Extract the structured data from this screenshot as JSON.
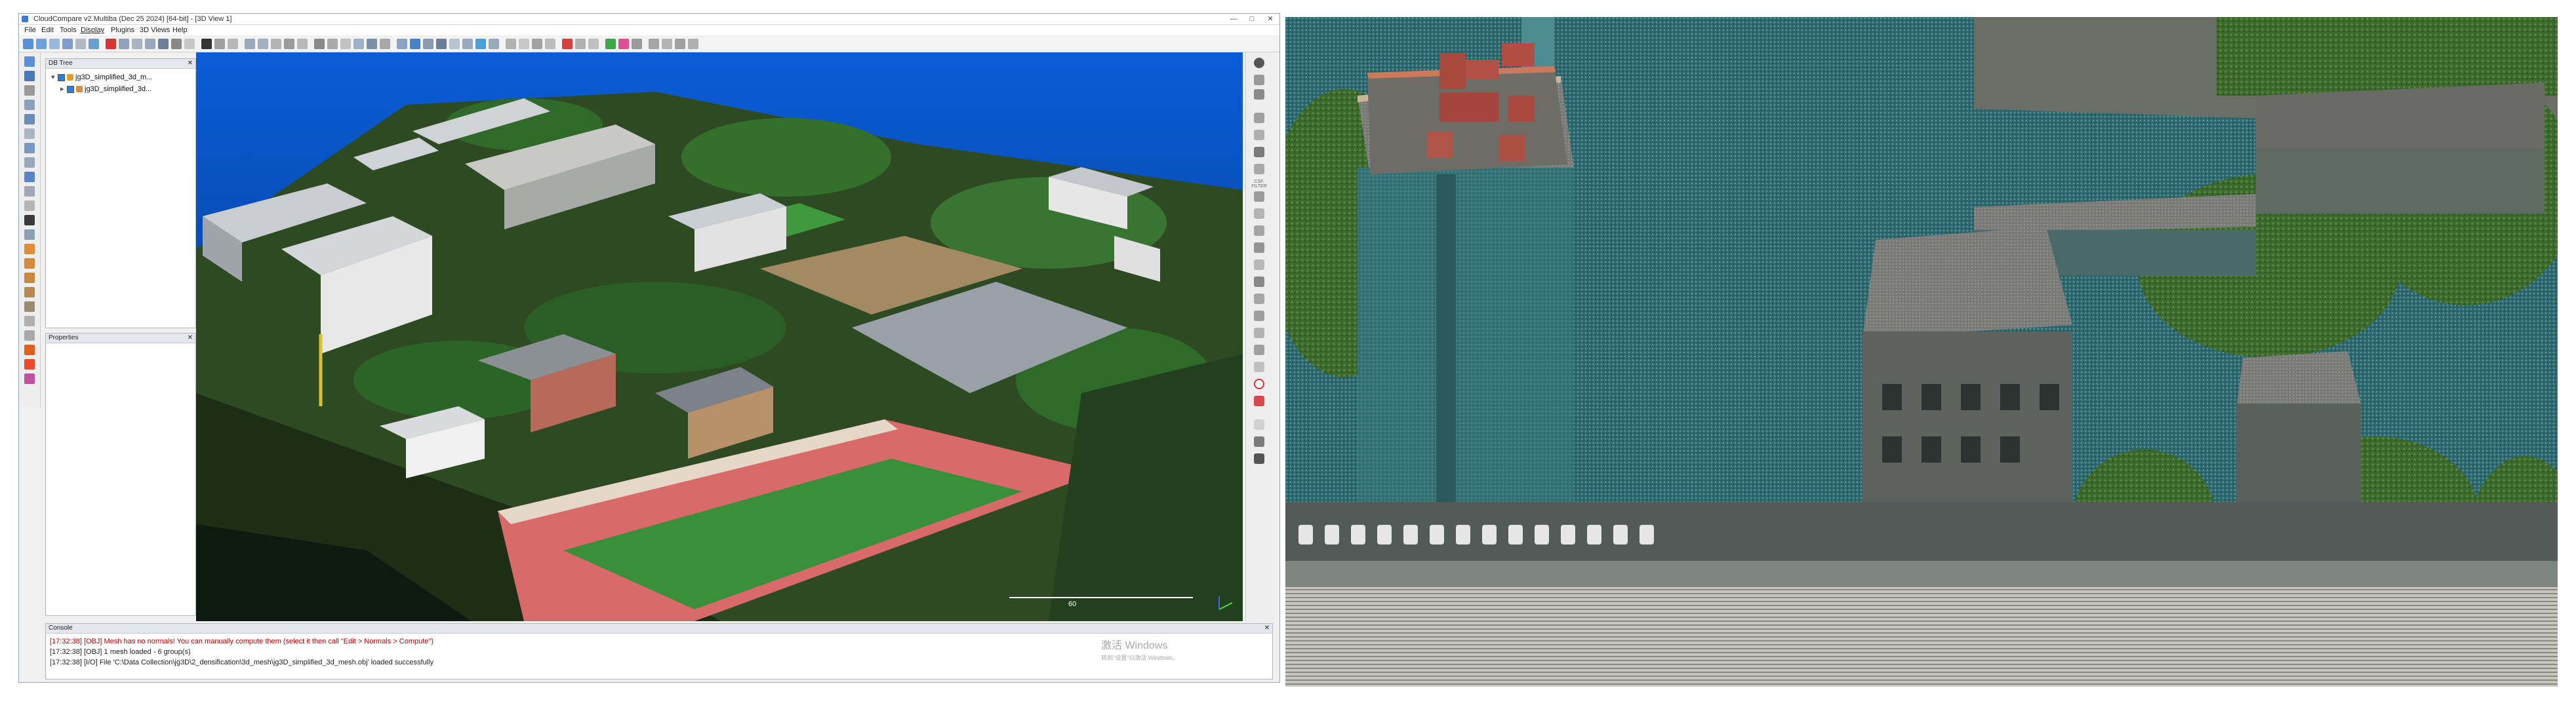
{
  "window": {
    "title": "CloudCompare v2.Multiba (Dec 25 2024) [64-bit] - [3D View 1]",
    "min_glyph": "—",
    "max_glyph": "□",
    "close_glyph": "✕"
  },
  "menu": [
    "File",
    "Edit",
    "Tools",
    "Display",
    "Plugins",
    "3D Views",
    "Help"
  ],
  "db_tree": {
    "header": "DB Tree",
    "items": [
      {
        "label": "jg3D_simplified_3d_m..."
      },
      {
        "label": "jg3D_simplified_3d..."
      }
    ]
  },
  "properties": {
    "header": "Properties"
  },
  "viewer": {
    "scale_label": "60",
    "side_label": "CSF. FILTER"
  },
  "console": {
    "header": "Console",
    "lines": [
      {
        "text": "[17:32:38] [OBJ] Mesh has no normals! You can manually compute them (select it then call \"Edit > Normals > Compute\")",
        "color": "#c00000"
      },
      {
        "text": "[17:32:38] [OBJ] 1 mesh loaded - 6 group(s)",
        "color": "#222222"
      },
      {
        "text": "[17:32:38] [I/O] File 'C:\\Data Collection\\jg3D\\2_densification\\3d_mesh\\jg3D_simplified_3d_mesh.obj' loaded successfully",
        "color": "#222222"
      }
    ]
  },
  "watermark": {
    "line1": "激活 Windows",
    "line2": "转到\"设置\"以激活 Windows。"
  },
  "colors": {
    "sky_blue": "#0a5cd6",
    "grass": "#3a8f3a",
    "track": "#d86a6a",
    "roof_red": "#a6463e"
  }
}
